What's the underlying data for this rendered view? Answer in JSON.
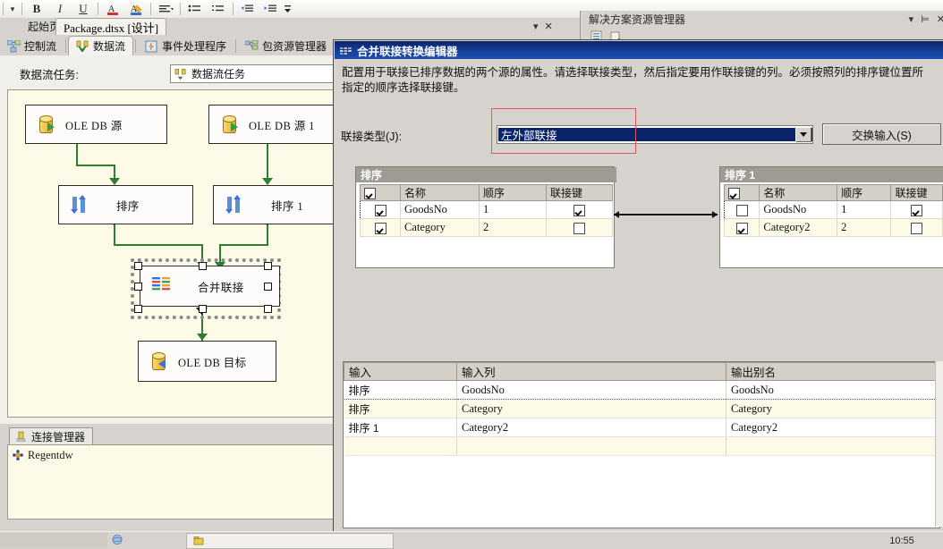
{
  "app": {
    "doc_tabs": [
      {
        "label": "起始页",
        "selected": false
      },
      {
        "label": "Package.dtsx [设计]",
        "selected": true
      }
    ],
    "tab_row_controls": {
      "dropdown": "▾",
      "close": "✕"
    },
    "designer_tabs": [
      {
        "label": "控制流",
        "icon": "control-flow-icon",
        "selected": false
      },
      {
        "label": "数据流",
        "icon": "data-flow-icon",
        "selected": true
      },
      {
        "label": "事件处理程序",
        "icon": "event-handlers-icon",
        "selected": false
      },
      {
        "label": "包资源管理器",
        "icon": "package-explorer-icon",
        "selected": false
      }
    ],
    "toolbar": {
      "bold": "B",
      "italic": "I",
      "underline": "U",
      "font_color": "A",
      "highlight": "A",
      "align": "≡",
      "bullets": "☰",
      "numbering": "☷",
      "indent1": "⇥",
      "indent2": "⇤",
      "overflow": "▾"
    }
  },
  "designer": {
    "task_label": "数据流任务:",
    "task_combo_value": "数据流任务",
    "task_combo_icon": "data-flow-task-icon",
    "nodes": [
      {
        "id": "ole-db-source",
        "label": "OLE DB 源",
        "icon": "ole-db-source-icon"
      },
      {
        "id": "ole-db-source-1",
        "label": "OLE DB 源 1",
        "icon": "ole-db-source-icon"
      },
      {
        "id": "sort",
        "label": "排序",
        "icon": "sort-icon"
      },
      {
        "id": "sort-1",
        "label": "排序 1",
        "icon": "sort-icon"
      },
      {
        "id": "merge-join",
        "label": "合并联接",
        "icon": "merge-join-icon",
        "selected": true
      },
      {
        "id": "ole-db-destination",
        "label": "OLE DB 目标",
        "icon": "ole-db-destination-icon"
      }
    ]
  },
  "connection_managers": {
    "tab_label": "连接管理器",
    "tab_icon": "connection-manager-icon",
    "items": [
      {
        "label": "Regentdw",
        "icon": "ole-db-connection-icon"
      }
    ]
  },
  "solution_explorer": {
    "title": "解决方案资源管理器",
    "controls": {
      "dropdown": "▾",
      "pin": "⊨",
      "close": "✕"
    },
    "toolbar": [
      {
        "name": "properties-icon",
        "glyph": "▤"
      },
      {
        "name": "refresh-icon",
        "glyph": "⟳"
      }
    ]
  },
  "dialog": {
    "title": "合并联接转换编辑器",
    "title_icon": "merge-join-icon",
    "description": "配置用于联接已排序数据的两个源的属性。请选择联接类型，然后指定要用作联接键的列。必须按照列的排序键位置所指定的顺序选择联接键。",
    "join_type_label": "联接类型(J):",
    "join_type_value": "左外部联接",
    "join_type_arrow": "▼",
    "swap_inputs_label": "交换输入(S)",
    "highlight_color": "#e4585c",
    "left_input": {
      "caption": "排序",
      "columns": [
        "",
        "名称",
        "顺序",
        "联接键"
      ],
      "header_checkbox": true,
      "rows": [
        {
          "checked": true,
          "name": "GoodsNo",
          "sort_order": "1",
          "join_key": true,
          "focused": true
        },
        {
          "checked": true,
          "name": "Category",
          "sort_order": "2",
          "join_key": false,
          "focused": false
        }
      ]
    },
    "right_input": {
      "caption": "排序 1",
      "columns": [
        "",
        "名称",
        "顺序",
        "联接键"
      ],
      "header_checkbox": true,
      "rows": [
        {
          "checked": false,
          "name": "GoodsNo",
          "sort_order": "1",
          "join_key": true,
          "focused": true
        },
        {
          "checked": true,
          "name": "Category2",
          "sort_order": "2",
          "join_key": false,
          "focused": false
        }
      ]
    },
    "output_grid": {
      "columns": [
        "输入",
        "输入列",
        "输出别名"
      ],
      "rows": [
        {
          "input": "排序",
          "input_column": "GoodsNo",
          "output_alias": "GoodsNo",
          "focused": true
        },
        {
          "input": "排序",
          "input_column": "Category",
          "output_alias": "Category",
          "focused": false
        },
        {
          "input": "排序 1",
          "input_column": "Category2",
          "output_alias": "Category2",
          "focused": false
        },
        {
          "input": "",
          "input_column": "",
          "output_alias": "",
          "focused": false
        }
      ]
    }
  },
  "taskbar": {
    "clock": "10:55"
  }
}
